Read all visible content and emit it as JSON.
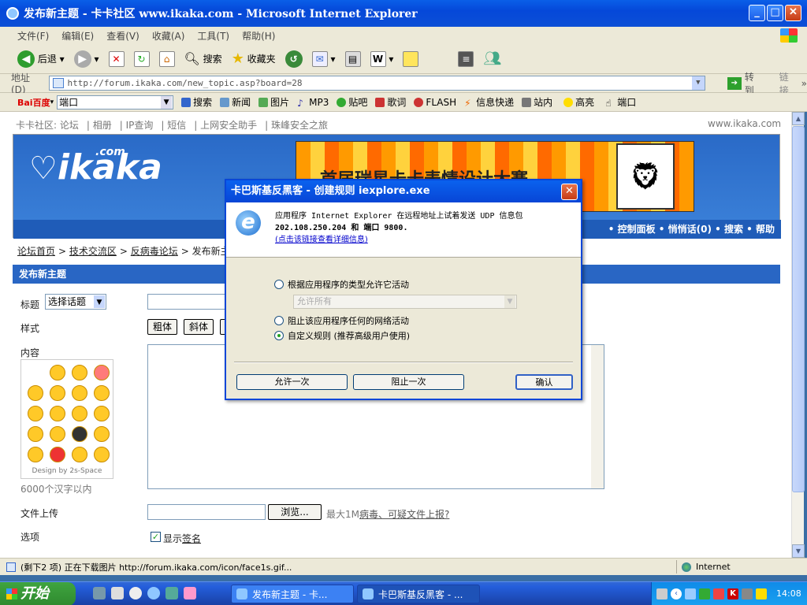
{
  "window": {
    "title": "发布新主题 - 卡卡社区 www.ikaka.com - Microsoft Internet Explorer"
  },
  "menu": [
    "文件(F)",
    "编辑(E)",
    "查看(V)",
    "收藏(A)",
    "工具(T)",
    "帮助(H)"
  ],
  "toolbar": {
    "back": "后退",
    "search": "搜索",
    "favorites": "收藏夹"
  },
  "address": {
    "label": "地址(D)",
    "url": "http://forum.ikaka.com/new_topic.asp?board=28",
    "go": "转到",
    "links": "链接"
  },
  "baidu": {
    "logo": "Bai百度",
    "input": "端口",
    "links": [
      "搜索",
      "新闻",
      "图片",
      "MP3",
      "贴吧",
      "歌词",
      "FLASH",
      "信息快递",
      "站内",
      "高亮",
      "端口"
    ]
  },
  "page": {
    "topnav": [
      "卡卡社区: 论坛",
      "相册",
      "IP查询",
      "短信",
      "上网安全助手",
      "珠峰安全之旅"
    ],
    "site": "www.ikaka.com",
    "logo": "ikaka",
    "logo_suffix": ".com",
    "ad_text": "首届瑞星卡卡表情设计大赛",
    "navstrip": "• 控制面板 • 悄悄话(0) • 搜索 • 帮助",
    "breadcrumbs": [
      "论坛首页",
      "技术交流区",
      "反病毒论坛",
      "发布新主题"
    ],
    "form_title": "发布新主题",
    "title_label": "标题",
    "topic_select": "选择话题",
    "style_label": "样式",
    "bold": "粗体",
    "italic": "斜体",
    "content_label": "内容",
    "smiley_caption": "Design by 2s-Space",
    "limit": "6000个汉字以内",
    "upload_label": "文件上传",
    "browse": "浏览...",
    "upload_note": "最大1M",
    "upload_link": "病毒、可疑文件上报?",
    "options_label": "选项",
    "show_signature_prefix": "显示",
    "show_signature_link": "签名"
  },
  "dialog": {
    "title": "卡巴斯基反黑客 - 创建规则 iexplore.exe",
    "line1": "应用程序 Internet Explorer 在远程地址上试着发送 UDP 信息包",
    "line2": "202.108.250.204 和 端口 9800.",
    "details_link": "(点击该链接查看详细信息)",
    "option1": "根据应用程序的类型允许它活动",
    "option1_select": "允许所有",
    "option2": "阻止该应用程序任何的网络活动",
    "option3": "自定义规则 (推荐高级用户使用)",
    "selected_option": 3,
    "allow_once": "允许一次",
    "block_once": "阻止一次",
    "ok": "确认"
  },
  "status": {
    "text": "(剩下2 项) 正在下载图片 http://forum.ikaka.com/icon/face1s.gif...",
    "zone": "Internet"
  },
  "taskbar": {
    "start": "开始",
    "tasks": [
      "发布新主题 - 卡...",
      "卡巴斯基反黑客 - ..."
    ],
    "clock": "14:08"
  }
}
